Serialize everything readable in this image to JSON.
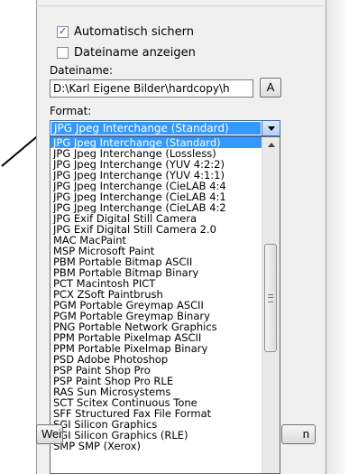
{
  "options": {
    "autosave_label": "Automatisch sichern",
    "autosave_checked": true,
    "show_filename_label": "Dateiname anzeigen",
    "show_filename_checked": false
  },
  "filename": {
    "label": "Dateiname:",
    "value": "D:\\Karl Eigene Bilder\\hardcopy\\h",
    "button_label": "A"
  },
  "format": {
    "label": "Format:",
    "selected": "JPG  Jpeg Interchange (Standard)",
    "items": [
      "JPG  Jpeg Interchange (Standard)",
      "JPG  Jpeg Interchange (Lossless)",
      "JPG  Jpeg Interchange (YUV 4:2:2)",
      "JPG  Jpeg Interchange (YUV 4:1:1)",
      "JPG  Jpeg Interchange (CieLAB 4:4",
      "JPG  Jpeg Interchange (CieLAB 4:1",
      "JPG  Jpeg Interchange (CieLAB 4:2",
      "JPG  Exif Digital Still Camera",
      "JPG  Exif Digital Still Camera 2.0",
      "MAC  MacPaint",
      "MSP  Microsoft Paint",
      "PBM  Portable Bitmap ASCII",
      "PBM  Portable Bitmap Binary",
      "PCT  Macintosh PICT",
      "PCX  ZSoft Paintbrush",
      "PGM  Portable Greymap ASCII",
      "PGM  Portable Greymap Binary",
      "PNG  Portable Network Graphics",
      "PPM  Portable Pixelmap ASCII",
      "PPM  Portable Pixelmap Binary",
      "PSD  Adobe Photoshop",
      "PSP  Paint Shop Pro",
      "PSP  Paint Shop Pro RLE",
      "RAS  Sun Microsystems",
      "SCT  Scitex Continuous Tone",
      "SFF  Structured Fax File Format",
      "SGI  Silicon Graphics",
      "SGI  Silicon Graphics (RLE)",
      "SMP  SMP (Xerox)"
    ]
  },
  "bottom": {
    "left_button_label": "Weit",
    "right_button_label": "n"
  },
  "icons": {
    "pointer": "arrow-pointer-icon",
    "dropdown": "chevron-down-icon",
    "scroll_up": "scroll-up-icon",
    "scroll_grip": "grip-icon"
  },
  "colors": {
    "selection": "#3399ff",
    "combo_border": "#3a6fc4",
    "panel_bg": "#f0f0f0"
  }
}
